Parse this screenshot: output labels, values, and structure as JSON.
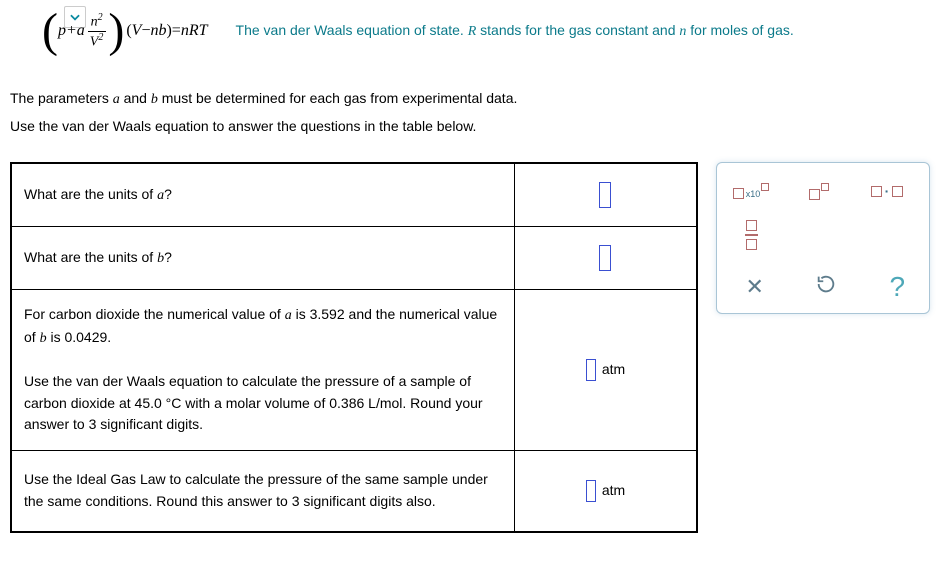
{
  "equation": {
    "prefix": "p",
    "plus": "+",
    "a": "a",
    "frac_num": "n",
    "frac_num_sup": "2",
    "frac_den_base": "V",
    "frac_den_sup": "2",
    "mid_open": "(",
    "term2_v": "V",
    "term2_minus": "−",
    "term2_n": "n",
    "term2_b": "b",
    "mid_close": ")",
    "eq": "=",
    "rhs_n": "n",
    "rhs_R": "R",
    "rhs_T": "T"
  },
  "caption": {
    "part1": "The van der Waals equation of state. ",
    "R": "R",
    "part2": " stands for the gas constant and ",
    "n": "n",
    "part3": " for moles of gas."
  },
  "paragraphs": {
    "p1_a": "The parameters ",
    "p1_b": "a",
    "p1_c": " and ",
    "p1_d": "b",
    "p1_e": " must be determined for each gas from experimental data.",
    "p2": "Use the van der Waals equation to answer the questions in the table below."
  },
  "questions": {
    "q1_a": "What are the units of ",
    "q1_b": "a",
    "q1_c": "?",
    "q2_a": "What are the units of ",
    "q2_b": "b",
    "q2_c": "?",
    "q3_a": "For carbon dioxide the numerical value of ",
    "q3_b": "a",
    "q3_c": " is ",
    "q3_d": "3.592",
    "q3_e": " and the numerical value of ",
    "q3_f": "b",
    "q3_g": " is ",
    "q3_h": "0.0429",
    "q3_i": ".",
    "q3_j": "Use the van der Waals equation to calculate the pressure of a sample of carbon dioxide at ",
    "q3_k": "45.0 °C",
    "q3_l": " with a molar volume of ",
    "q3_m": "0.386  L/mol",
    "q3_n": ". Round your answer to ",
    "q3_o": "3",
    "q3_p": " significant digits.",
    "q4_a": "Use the Ideal Gas Law to calculate the pressure of the same sample under the same conditions. Round this answer to ",
    "q4_b": "3",
    "q4_c": " significant digits also."
  },
  "answers": {
    "unit3": "atm",
    "unit4": "atm"
  },
  "toolbox": {
    "x10": "x10",
    "dot": "·",
    "clear": "✕",
    "reset": "↺",
    "help": "?"
  }
}
